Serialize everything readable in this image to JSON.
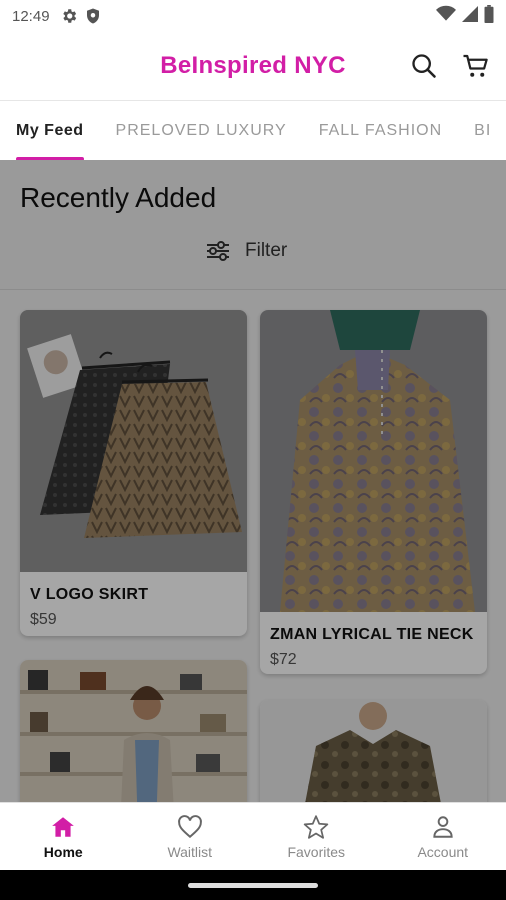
{
  "status_bar": {
    "time": "12:49"
  },
  "header": {
    "brand": "BeInspired NYC"
  },
  "tabs": [
    {
      "label": "My Feed",
      "active": true
    },
    {
      "label": "PRELOVED LUXURY",
      "active": false
    },
    {
      "label": "FALL FASHION",
      "active": false
    },
    {
      "label": "BI",
      "active": false
    }
  ],
  "feed": {
    "section_title": "Recently Added",
    "filter_label": "Filter",
    "products": [
      {
        "name": "V LOGO SKIRT",
        "price": "$59"
      },
      {
        "name": "ZMAN LYRICAL TIE NECK",
        "price": "$72"
      }
    ]
  },
  "bottom_nav": [
    {
      "label": "Home",
      "icon": "home-icon",
      "active": true
    },
    {
      "label": "Waitlist",
      "icon": "heart-icon",
      "active": false
    },
    {
      "label": "Favorites",
      "icon": "star-icon",
      "active": false
    },
    {
      "label": "Account",
      "icon": "account-icon",
      "active": false
    }
  ],
  "colors": {
    "brand": "#d21ea6",
    "scrim": "rgba(0,0,0,0.35)"
  }
}
